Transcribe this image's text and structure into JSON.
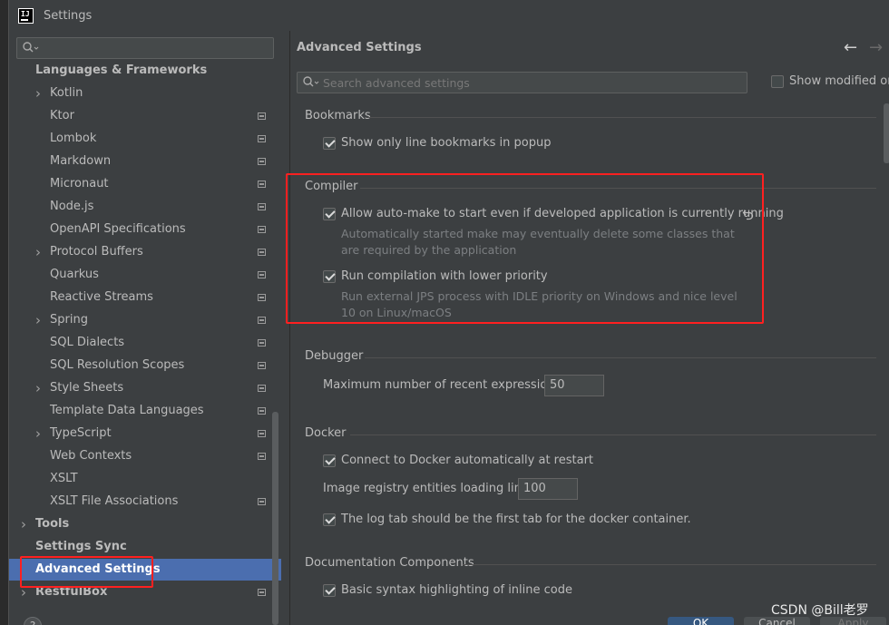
{
  "window": {
    "title": "Settings",
    "logo_text": "IJ"
  },
  "sidebar": {
    "search_value": "",
    "items": [
      {
        "label": "Languages & Frameworks",
        "bold": true,
        "arrow": "",
        "icon": false
      },
      {
        "label": "Kotlin",
        "arrow": ">",
        "icon": false
      },
      {
        "label": "Ktor",
        "arrow": "",
        "icon": true
      },
      {
        "label": "Lombok",
        "arrow": "",
        "icon": true
      },
      {
        "label": "Markdown",
        "arrow": "",
        "icon": true
      },
      {
        "label": "Micronaut",
        "arrow": "",
        "icon": true
      },
      {
        "label": "Node.js",
        "arrow": "",
        "icon": true
      },
      {
        "label": "OpenAPI Specifications",
        "arrow": "",
        "icon": true
      },
      {
        "label": "Protocol Buffers",
        "arrow": ">",
        "icon": true
      },
      {
        "label": "Quarkus",
        "arrow": "",
        "icon": true
      },
      {
        "label": "Reactive Streams",
        "arrow": "",
        "icon": true
      },
      {
        "label": "Spring",
        "arrow": ">",
        "icon": true
      },
      {
        "label": "SQL Dialects",
        "arrow": "",
        "icon": true
      },
      {
        "label": "SQL Resolution Scopes",
        "arrow": "",
        "icon": true
      },
      {
        "label": "Style Sheets",
        "arrow": ">",
        "icon": true
      },
      {
        "label": "Template Data Languages",
        "arrow": "",
        "icon": true
      },
      {
        "label": "TypeScript",
        "arrow": ">",
        "icon": true
      },
      {
        "label": "Web Contexts",
        "arrow": "",
        "icon": true
      },
      {
        "label": "XSLT",
        "arrow": "",
        "icon": false
      },
      {
        "label": "XSLT File Associations",
        "arrow": "",
        "icon": true
      },
      {
        "label": "Tools",
        "bold": true,
        "arrow": ">",
        "icon": false
      },
      {
        "label": "Settings Sync",
        "bold": true,
        "arrow": "",
        "icon": false
      },
      {
        "label": "Advanced Settings",
        "bold": true,
        "arrow": "",
        "icon": false,
        "selected": true
      },
      {
        "label": "RestfulBox",
        "bold": true,
        "arrow": ">",
        "icon": true
      }
    ],
    "help_label": "?"
  },
  "content": {
    "title": "Advanced Settings",
    "search_placeholder": "Search advanced settings",
    "show_modified_label": "Show modified only",
    "bookmarks": {
      "title": "Bookmarks",
      "option": "Show only line bookmarks in popup"
    },
    "compiler": {
      "title": "Compiler",
      "auto_make": "Allow auto-make to start even if developed application is currently running",
      "auto_make_desc_1": "Automatically started make may eventually delete some classes that",
      "auto_make_desc_2": "are required by the application",
      "lower_priority": "Run compilation with lower priority",
      "lower_priority_desc_1": "Run external JPS process with IDLE priority on Windows and nice level",
      "lower_priority_desc_2": "10 on Linux/macOS"
    },
    "debugger": {
      "title": "Debugger",
      "max_expr_label": "Maximum number of recent expressions:",
      "max_expr_value": "50"
    },
    "docker": {
      "title": "Docker",
      "connect": "Connect to Docker automatically at restart",
      "registry_label": "Image registry entities loading limit:",
      "registry_value": "100",
      "log_tab": "The log tab should be the first tab for the docker container."
    },
    "doc_components": {
      "title": "Documentation Components",
      "option": "Basic syntax highlighting of inline code"
    }
  },
  "footer": {
    "ok": "OK",
    "cancel": "Cancel",
    "apply": "Apply"
  },
  "watermark": "CSDN @Bill老罗",
  "colors": {
    "selection": "#4b6eaf",
    "highlight_box": "#ff2020",
    "panel": "#3c3f41"
  }
}
